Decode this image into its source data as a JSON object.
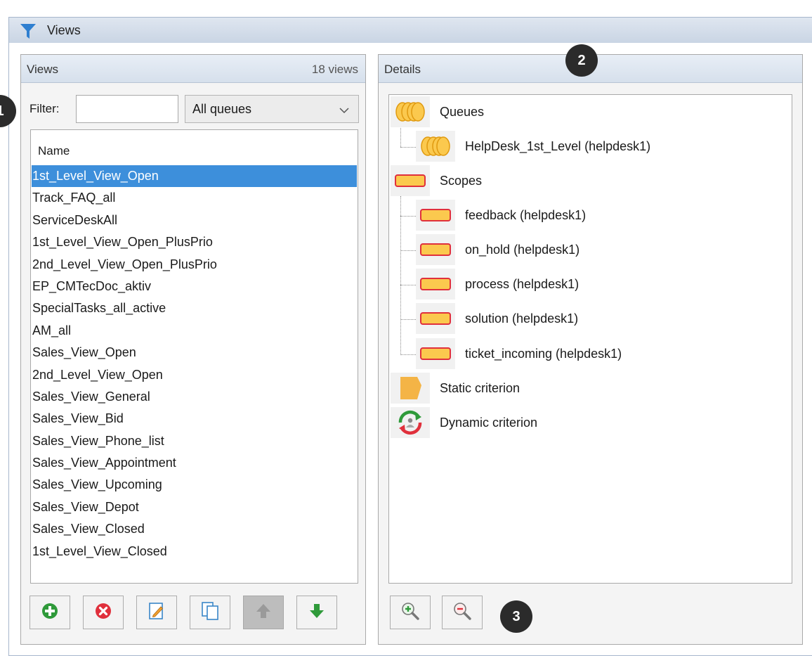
{
  "window": {
    "title": "Views"
  },
  "views_panel": {
    "title": "Views",
    "count": "18 views",
    "filter_label": "Filter:",
    "filter_value": "",
    "queue_select": "All queues",
    "column_header": "Name",
    "selected_index": 0,
    "items": [
      "1st_Level_View_Open",
      "Track_FAQ_all",
      "ServiceDeskAll",
      "1st_Level_View_Open_PlusPrio",
      "2nd_Level_View_Open_PlusPrio",
      "EP_CMTecDoc_aktiv",
      "SpecialTasks_all_active",
      "AM_all",
      "Sales_View_Open",
      "2nd_Level_View_Open",
      "Sales_View_General",
      "Sales_View_Bid",
      "Sales_View_Phone_list",
      "Sales_View_Appointment",
      "Sales_View_Upcoming",
      "Sales_View_Depot",
      "Sales_View_Closed",
      "1st_Level_View_Closed"
    ],
    "toolbar": [
      {
        "name": "add",
        "icon": "plus-circle-icon",
        "disabled": false
      },
      {
        "name": "delete",
        "icon": "x-circle-icon",
        "disabled": false
      },
      {
        "name": "edit",
        "icon": "edit-document-icon",
        "disabled": false
      },
      {
        "name": "copy",
        "icon": "copy-document-icon",
        "disabled": false
      },
      {
        "name": "move-up",
        "icon": "arrow-up-icon",
        "disabled": true
      },
      {
        "name": "move-down",
        "icon": "arrow-down-icon",
        "disabled": false
      }
    ]
  },
  "details_panel": {
    "title": "Details",
    "tree": {
      "queues_label": "Queues",
      "queue_items": [
        "HelpDesk_1st_Level (helpdesk1)"
      ],
      "scopes_label": "Scopes",
      "scope_items": [
        "feedback (helpdesk1)",
        "on_hold (helpdesk1)",
        "process (helpdesk1)",
        "solution (helpdesk1)",
        "ticket_incoming (helpdesk1)"
      ],
      "static_label": "Static criterion",
      "dynamic_label": "Dynamic criterion"
    },
    "zoom_in_icon": "zoom-in-icon",
    "zoom_out_icon": "zoom-out-icon"
  },
  "callouts": [
    "1",
    "2",
    "3"
  ],
  "colors": {
    "selection": "#3d8fdb",
    "header_gradient": "#d6e0ec",
    "scope_yellow": "#fbc94e",
    "callout": "#2b2b2b"
  }
}
